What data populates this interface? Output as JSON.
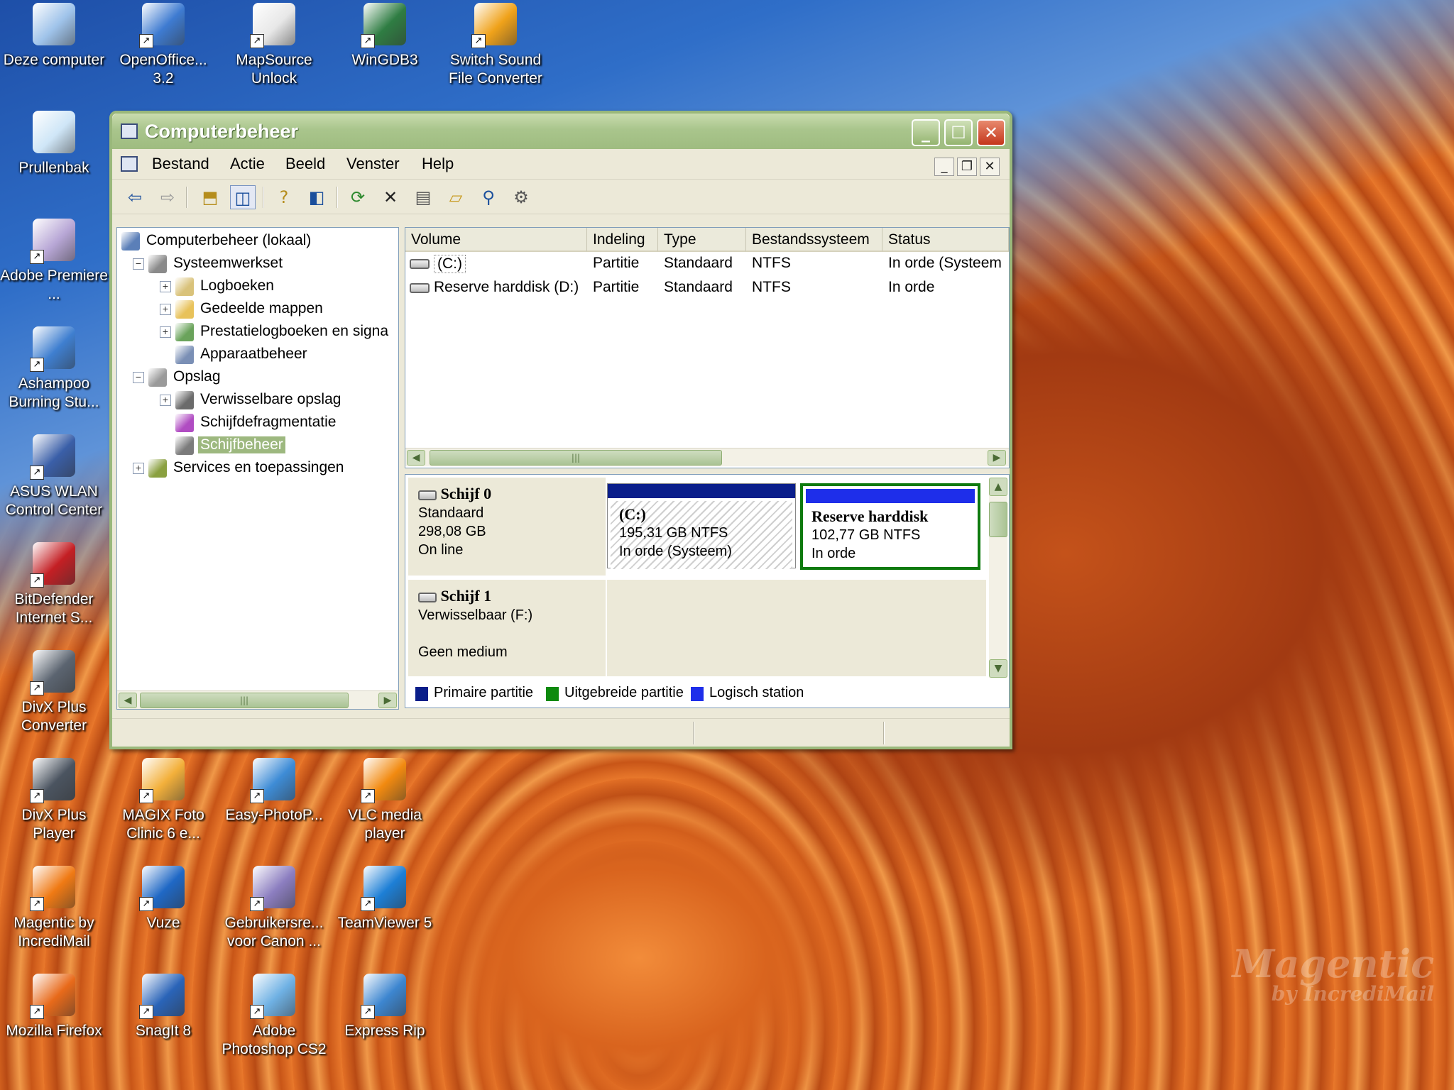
{
  "desktop": {
    "icons": [
      {
        "label": "Deze computer",
        "icon": "my-computer-icon",
        "color": "#9fc3ea"
      },
      {
        "label": "OpenOffice... 3.2",
        "icon": "openoffice-icon",
        "color": "#3e7bd1"
      },
      {
        "label": "MapSource Unlock",
        "icon": "mapsource-icon",
        "color": "#e8e8e8"
      },
      {
        "label": "WinGDB3",
        "icon": "wingdb-icon",
        "color": "#2f7d43"
      },
      {
        "label": "Switch Sound File Converter",
        "icon": "switch-icon",
        "color": "#f0a21a"
      },
      {
        "label": "Prullenbak",
        "icon": "recycle-bin-icon",
        "color": "#cfe6f7"
      },
      {
        "label": "Adobe Premiere ...",
        "icon": "premiere-icon",
        "color": "#b8a7d6"
      },
      {
        "label": "Ashampoo Burning Stu...",
        "icon": "ashampoo-icon",
        "color": "#3f7fd0"
      },
      {
        "label": "ASUS WLAN Control Center",
        "icon": "asus-wlan-icon",
        "color": "#3a5fa8"
      },
      {
        "label": "BitDefender Internet S...",
        "icon": "bitdefender-icon",
        "color": "#c41f24"
      },
      {
        "label": "DivX Plus Converter",
        "icon": "divx-converter-icon",
        "color": "#5b6470"
      },
      {
        "label": "DivX Plus Player",
        "icon": "divx-player-icon",
        "color": "#4b5460"
      },
      {
        "label": "MAGIX Foto Clinic 6 e...",
        "icon": "magix-icon",
        "color": "#f3b03b"
      },
      {
        "label": "Easy-PhotoP...",
        "icon": "easyphoto-icon",
        "color": "#3e8cd6"
      },
      {
        "label": "VLC media player",
        "icon": "vlc-icon",
        "color": "#f28a10"
      },
      {
        "label": "Magentic by IncrediMail",
        "icon": "magentic-icon",
        "color": "#f07a14"
      },
      {
        "label": "Vuze",
        "icon": "vuze-icon",
        "color": "#1f68c5"
      },
      {
        "label": "Gebruikersre... voor Canon ...",
        "icon": "canon-user-icon",
        "color": "#8c7ec0"
      },
      {
        "label": "TeamViewer 5",
        "icon": "teamviewer-icon",
        "color": "#1d7fd6"
      },
      {
        "label": "Mozilla Firefox",
        "icon": "firefox-icon",
        "color": "#e86a1a"
      },
      {
        "label": "SnagIt 8",
        "icon": "snagit-icon",
        "color": "#2a64b8"
      },
      {
        "label": "Adobe Photoshop CS2",
        "icon": "photoshop-icon",
        "color": "#6fb1e4"
      },
      {
        "label": "Express Rip",
        "icon": "expressrip-icon",
        "color": "#3d86d0"
      }
    ],
    "watermark": {
      "big": "Magentic",
      "small": "by IncrediMail"
    }
  },
  "window": {
    "title": "Computerbeheer",
    "menu": [
      "Bestand",
      "Actie",
      "Beeld",
      "Venster",
      "Help"
    ],
    "toolbar_icons": [
      "back-icon",
      "forward-icon",
      "up-folder-icon",
      "show-tree-icon",
      "help-icon",
      "split-icon",
      "refresh-icon",
      "delete-icon",
      "properties-icon",
      "open-icon",
      "search-icon",
      "settings-icon"
    ],
    "tree": [
      {
        "label": "Computerbeheer (lokaal)",
        "level": 0,
        "expander": "",
        "icon": "computer-icon"
      },
      {
        "label": "Systeemwerkset",
        "level": 1,
        "expander": "−",
        "icon": "tools-icon"
      },
      {
        "label": "Logboeken",
        "level": 2,
        "expander": "+",
        "icon": "event-viewer-icon"
      },
      {
        "label": "Gedeelde mappen",
        "level": 2,
        "expander": "+",
        "icon": "shared-folder-icon"
      },
      {
        "label": "Prestatielogboeken en signa",
        "level": 2,
        "expander": "+",
        "icon": "performance-icon"
      },
      {
        "label": "Apparaatbeheer",
        "level": 2,
        "expander": "",
        "icon": "device-manager-icon"
      },
      {
        "label": "Opslag",
        "level": 1,
        "expander": "−",
        "icon": "storage-icon"
      },
      {
        "label": "Verwisselbare opslag",
        "level": 2,
        "expander": "+",
        "icon": "removable-storage-icon"
      },
      {
        "label": "Schijfdefragmentatie",
        "level": 2,
        "expander": "",
        "icon": "defrag-icon"
      },
      {
        "label": "Schijfbeheer",
        "level": 2,
        "expander": "",
        "icon": "disk-management-icon",
        "selected": true
      },
      {
        "label": "Services en toepassingen",
        "level": 1,
        "expander": "+",
        "icon": "services-icon"
      }
    ],
    "volume_list": {
      "columns": [
        "Volume",
        "Indeling",
        "Type",
        "Bestandssysteem",
        "Status"
      ],
      "rows": [
        {
          "volume": "(C:)",
          "indeling": "Partitie",
          "type": "Standaard",
          "fs": "NTFS",
          "status": "In orde (Systeem"
        },
        {
          "volume": "Reserve harddisk (D:)",
          "indeling": "Partitie",
          "type": "Standaard",
          "fs": "NTFS",
          "status": "In orde"
        }
      ]
    },
    "disks": [
      {
        "name": "Schijf 0",
        "line1": "Standaard",
        "line2": "298,08 GB",
        "line3": "On line"
      },
      {
        "name": "Schijf 1",
        "line1": "Verwisselbaar (F:)",
        "line2": "",
        "line3": "Geen medium"
      }
    ],
    "partitions": [
      {
        "name": "(C:)",
        "size": "195,31 GB NTFS",
        "status": "In orde (Systeem)"
      },
      {
        "name": "Reserve harddisk",
        "size": "102,77 GB NTFS",
        "status": "In orde"
      }
    ],
    "legend": [
      {
        "label": "Primaire partitie",
        "color": "#0a1e8a"
      },
      {
        "label": "Uitgebreide partitie",
        "color": "#0e8a0e"
      },
      {
        "label": "Logisch station",
        "color": "#1e2eea"
      }
    ]
  }
}
